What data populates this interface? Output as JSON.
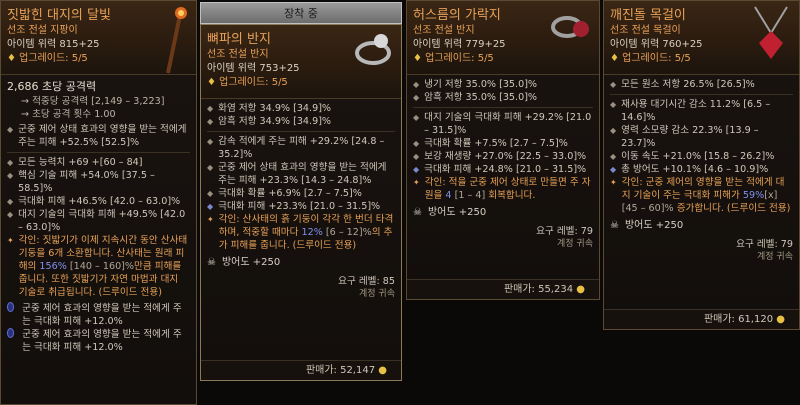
{
  "equipped_tab": "장착 중",
  "cards": [
    {
      "name": "짓밟힌 대지의 달빛",
      "type": "선조 전설 지팡이",
      "power": "아이템 위력 815+25",
      "upgrades": "업그레이드: 5/5",
      "dps": "2,686 초당 공격력",
      "dps_lines": [
        "적중당 공격력 [2,149 – 3,223]",
        "초당 공격 횟수 1.00"
      ],
      "implicit": "군중 제어 상태 효과의 영향을 받는 적에게 주는 피해 +52.5% [52.5]%",
      "affixes": [
        "모든 능력치 +69 +[60 – 84]",
        "핵심 기술 피해 +54.0% [37.5 – 58.5]%",
        "극대화 피해 +46.5% [42.0 – 63.0]%",
        "대지 기술의 극대화 피해 +49.5% [42.0 – 63.0]%"
      ],
      "aspect_prefix": "각인:",
      "aspect_text": "짓밟기가 이제 지속시간 동안 산사태 기둥을 6개 소환합니다. 산사태는 원래 피해의",
      "aspect_value": "156%",
      "aspect_range": "[140 – 160]%",
      "aspect_text2": "만큼 피해를 줍니다. 또한 짓밟기가 자연 마법과 대지 기술로 취급됩니다. (드루이드 전용)",
      "socket_lines": [
        "군중 제어 효과의 영향을 받는 적에게 주는 극대화 피해 +12.0%",
        "군중 제어 효과의 영향을 받는 적에게 주는 극대화 피해 +12.0%"
      ],
      "icon": "staff-icon"
    },
    {
      "name": "뼈파의 반지",
      "type": "선조 전설 반지",
      "power": "아이템 위력 753+25",
      "upgrades": "업그레이드: 5/5",
      "implicits": [
        "화염 저항 34.9% [34.9]%",
        "암흑 저항 34.9% [34.9]%"
      ],
      "affixes": [
        "감속 적에게 주는 피해 +29.2% [24.8 – 35.2]%",
        "군중 제어 상태 효과의 영향을 받는 적에게 주는 피해 +23.3% [14.3 – 24.8]%",
        "극대화 확률 +6.9% [2.7 – 7.5]%",
        "극대화 피해 +23.3% [21.0 – 31.5]%"
      ],
      "aspect_prefix": "각인:",
      "aspect_text": "산사태의 흙 기둥이 각각 한 번더 타격하며, 적중할 때마다",
      "aspect_value": "12%",
      "aspect_range": "[6 – 12]%",
      "aspect_text2": "의 추가 피해를 줍니다. (드루이드 전용)",
      "armor": "방어도 +250",
      "req": "요구 레벨: 85",
      "bound": "계정 귀속",
      "price_label": "판매가: 52,147",
      "icon": "ring-icon"
    },
    {
      "name": "허스름의 가락지",
      "type": "선조 전설 반지",
      "power": "아이템 위력 779+25",
      "upgrades": "업그레이드: 5/5",
      "implicits": [
        "냉기 저항 35.0% [35.0]%",
        "암흑 저항 35.0% [35.0]%"
      ],
      "affixes": [
        "대지 기술의 극대화 피해 +29.2% [21.0 – 31.5]%",
        "극대화 확률 +7.5% [2.7 – 7.5]%",
        "보강 재생량 +27.0% [22.5 – 33.0]%",
        "극대화 피해 +24.8% [21.0 – 31.5]%"
      ],
      "aspect_prefix": "각인:",
      "aspect_text": "적을 군중 제어 상태로 만들면 주 자원을",
      "aspect_value": "4",
      "aspect_range": "[1 – 4]",
      "aspect_text2": "회복합니다.",
      "armor": "방어도 +250",
      "req": "요구 레벨: 79",
      "bound": "계정 귀속",
      "price_label": "판매가: 55,234",
      "icon": "ring-icon"
    },
    {
      "name": "깨진돌 목걸이",
      "type": "선조 전설 목걸이",
      "power": "아이템 위력 760+25",
      "upgrades": "업그레이드: 5/5",
      "implicits": [
        "모든 원소 저항 26.5% [26.5]%"
      ],
      "affixes": [
        "재사용 대기시간 감소 11.2% [6.5 – 14.6]%",
        "영력 소모량 감소 22.3% [13.9 – 23.7]%",
        "이동 속도 +21.0% [15.8 – 26.2]%",
        "총 방어도 +10.1% [4.6 – 10.9]%"
      ],
      "aspect_prefix": "각인:",
      "aspect_text": "군중 제어의 영향을 받는 적에게 대지 기술이 주는 극대화 피해가",
      "aspect_value": "59%",
      "aspect_range": "[x] [45 – 60]%",
      "aspect_text2": "증가합니다. (드루이드 전용)",
      "armor": "방어도 +250",
      "req": "요구 레벨: 79",
      "bound": "계정 귀속",
      "price_label": "판매가: 61,120",
      "icon": "amulet-icon"
    }
  ]
}
